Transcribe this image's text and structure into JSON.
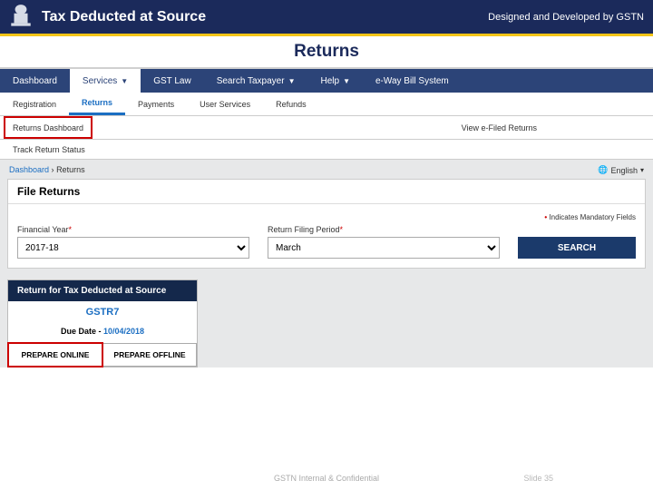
{
  "header": {
    "title": "Tax Deducted at Source",
    "credit": "Designed and Developed by GSTN"
  },
  "section_title": "Returns",
  "nav1": {
    "dashboard": "Dashboard",
    "services": "Services",
    "gst_law": "GST Law",
    "search_taxpayer": "Search Taxpayer",
    "help": "Help",
    "eway": "e-Way Bill System"
  },
  "nav2": {
    "registration": "Registration",
    "returns": "Returns",
    "payments": "Payments",
    "user_services": "User Services",
    "refunds": "Refunds"
  },
  "nav3": {
    "returns_dashboard": "Returns Dashboard",
    "view_efiled": "View e-Filed Returns"
  },
  "nav4": {
    "track_status": "Track Return Status"
  },
  "crumbs": {
    "dashboard": "Dashboard",
    "sep": "›",
    "current": "Returns",
    "lang": "English"
  },
  "panel": {
    "title": "File Returns",
    "mandatory": "Indicates Mandatory Fields",
    "fy_label": "Financial Year",
    "fy_value": "2017-18",
    "period_label": "Return Filing Period",
    "period_value": "March",
    "search": "SEARCH"
  },
  "card": {
    "title": "Return for Tax Deducted at Source",
    "sub": "GSTR7",
    "due_label": "Due Date -",
    "due_date": "10/04/2018",
    "prepare_online": "PREPARE ONLINE",
    "prepare_offline": "PREPARE OFFLINE"
  },
  "footer": {
    "confidential": "GSTN Internal & Confidential",
    "slide": "Slide 35"
  }
}
